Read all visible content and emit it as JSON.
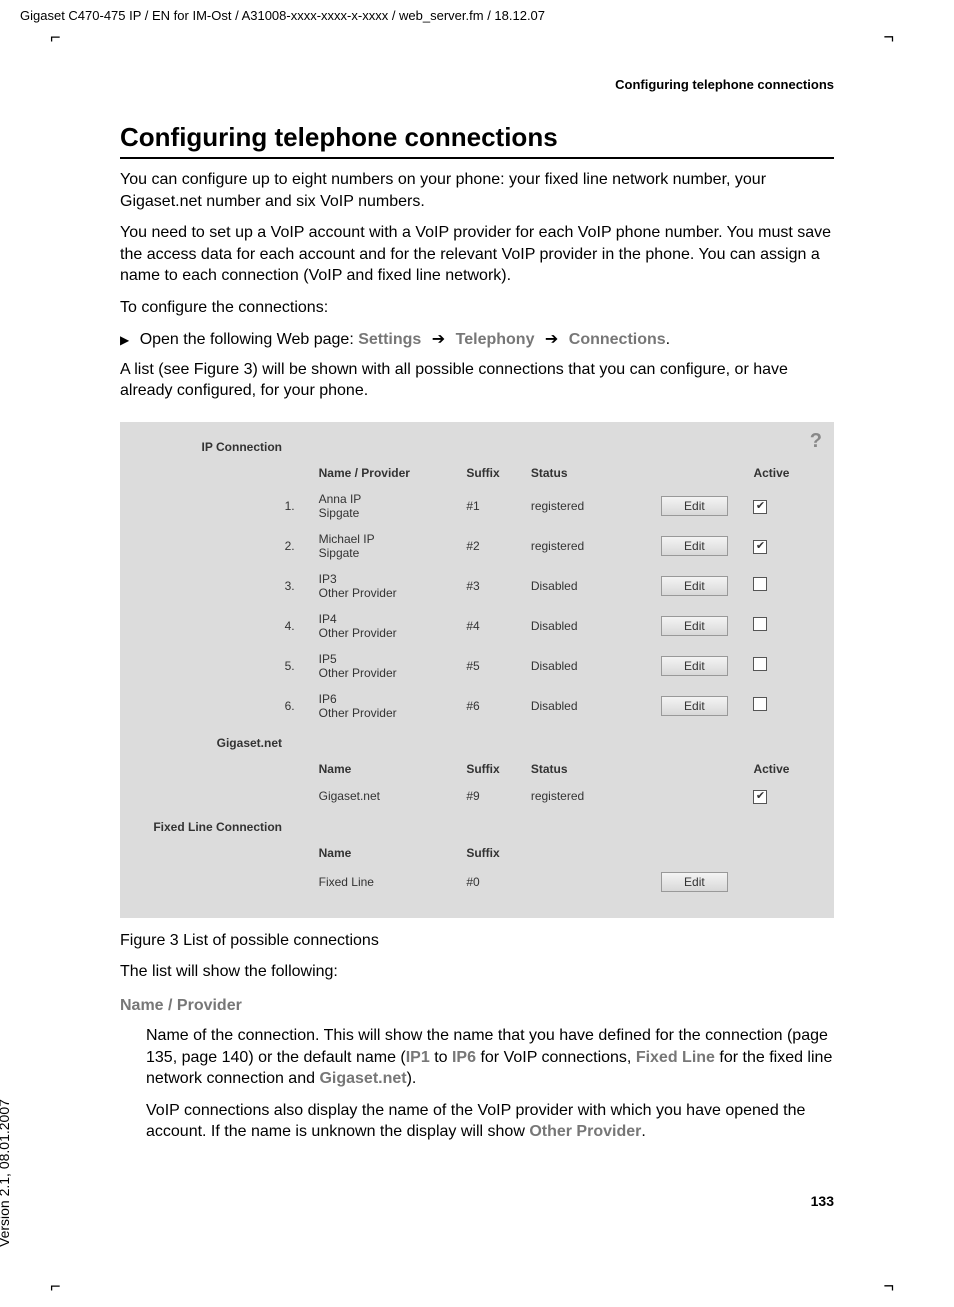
{
  "meta": {
    "header": "Gigaset C470-475 IP / EN for IM-Ost / A31008-xxxx-xxxx-x-xxxx / web_server.fm / 18.12.07",
    "running_head": "Configuring telephone connections",
    "version": "Version 2.1, 08.01.2007",
    "page_number": "133"
  },
  "heading": "Configuring telephone connections",
  "intro": {
    "p1": "You can configure up to eight numbers on your phone: your fixed line network number, your Gigaset.net number and six VoIP numbers.",
    "p2": "You need to set up a VoIP account with a VoIP provider for each VoIP phone number. You must save the access data for each account and for the relevant VoIP provider in the phone. You can assign a name to each connection (VoIP and fixed line network).",
    "p3": "To configure the connections:",
    "nav_prefix": "Open the following Web page: ",
    "nav_1": "Settings",
    "nav_2": "Telephony",
    "nav_3": "Connections",
    "nav_suffix": ".",
    "p4": "A list (see Figure 3) will be shown with all possible connections that you can configure, or have already configured, for your phone."
  },
  "panel": {
    "ip_title": "IP Connection",
    "headers": {
      "name": "Name / Provider",
      "suffix": "Suffix",
      "status": "Status",
      "active": "Active"
    },
    "edit_label": "Edit",
    "ip_rows": [
      {
        "num": "1.",
        "line1": "Anna IP",
        "line2": "Sipgate",
        "suffix": "#1",
        "status": "registered",
        "active": true
      },
      {
        "num": "2.",
        "line1": "Michael IP",
        "line2": "Sipgate",
        "suffix": "#2",
        "status": "registered",
        "active": true
      },
      {
        "num": "3.",
        "line1": "IP3",
        "line2": "Other Provider",
        "suffix": "#3",
        "status": "Disabled",
        "active": false
      },
      {
        "num": "4.",
        "line1": "IP4",
        "line2": "Other Provider",
        "suffix": "#4",
        "status": "Disabled",
        "active": false
      },
      {
        "num": "5.",
        "line1": "IP5",
        "line2": "Other Provider",
        "suffix": "#5",
        "status": "Disabled",
        "active": false
      },
      {
        "num": "6.",
        "line1": "IP6",
        "line2": "Other Provider",
        "suffix": "#6",
        "status": "Disabled",
        "active": false
      }
    ],
    "gigaset_title": "Gigaset.net",
    "gigaset_headers": {
      "name": "Name",
      "suffix": "Suffix",
      "status": "Status",
      "active": "Active"
    },
    "gigaset_row": {
      "name": "Gigaset.net",
      "suffix": "#9",
      "status": "registered",
      "active": true
    },
    "fixed_title": "Fixed Line Connection",
    "fixed_headers": {
      "name": "Name",
      "suffix": "Suffix"
    },
    "fixed_row": {
      "name": "Fixed Line",
      "suffix": "#0"
    }
  },
  "caption": "Figure 3   List of possible connections",
  "list_intro": "The list will show the following:",
  "def": {
    "label": "Name / Provider",
    "p1a": "Name of the connection. This will show the name that you have defined for the connection (page 135, page 140) or the default name (",
    "ip1": "IP1",
    "to": " to ",
    "ip6": "IP6",
    "p1b": " for VoIP connections, ",
    "fixed": "Fixed Line",
    "p1c": " for the fixed line network connection and ",
    "gig": "Gigaset.net",
    "p1d": ").",
    "p2a": "VoIP connections also display the name of the VoIP provider with which you have opened the account. If the name is unknown the display will show ",
    "other": "Other Provider",
    "p2b": "."
  }
}
